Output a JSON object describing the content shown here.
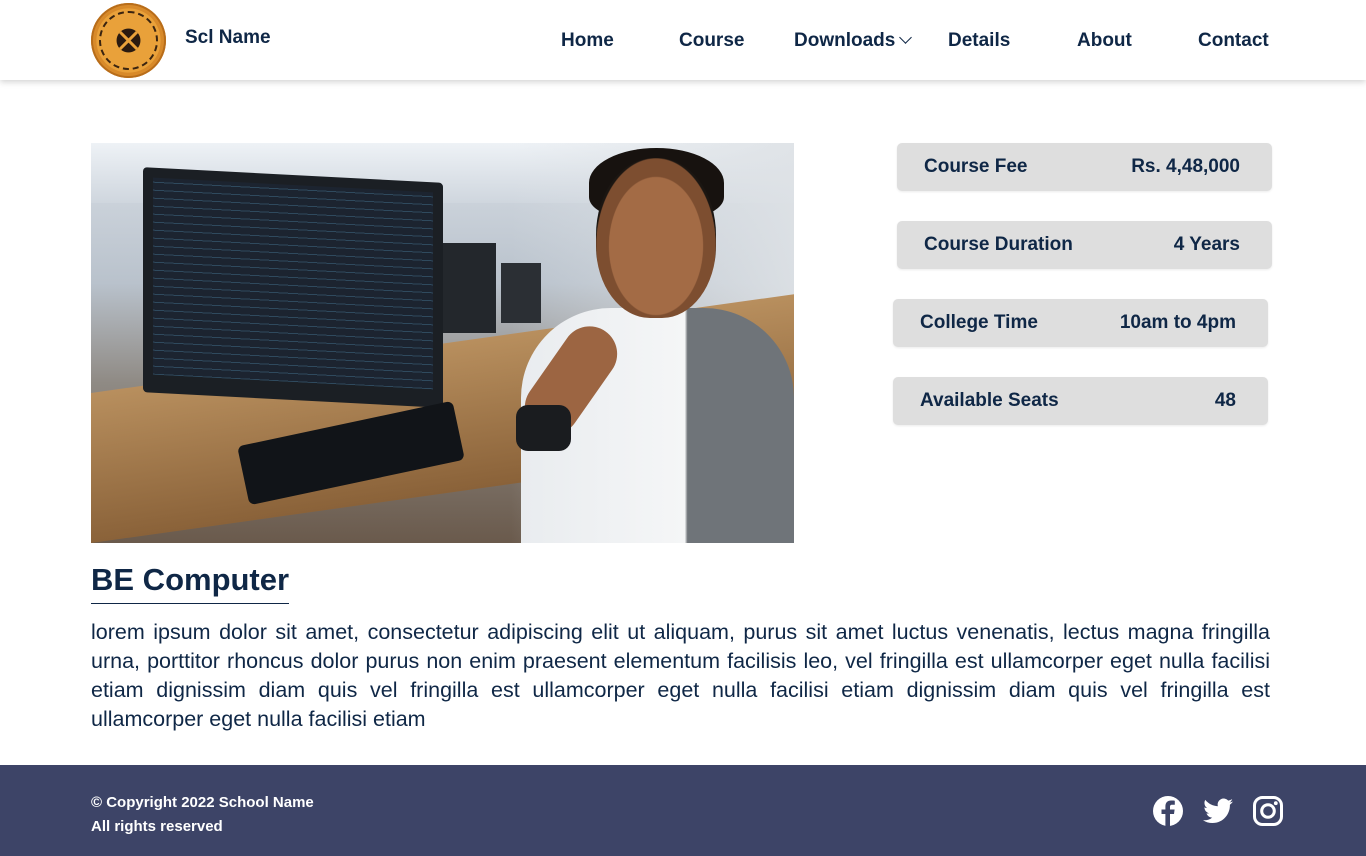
{
  "header": {
    "brand": "Scl Name",
    "nav": {
      "home": "Home",
      "course": "Course",
      "downloads": "Downloads",
      "details": "Details",
      "about": "About",
      "contact": "Contact"
    }
  },
  "info": [
    {
      "label": "Course Fee",
      "value": "Rs. 4,48,000"
    },
    {
      "label": "Course Duration",
      "value": "4 Years"
    },
    {
      "label": "College Time",
      "value": "10am to 4pm"
    },
    {
      "label": "Available Seats",
      "value": "48"
    }
  ],
  "course": {
    "title": "BE Computer",
    "description": "lorem ipsum dolor sit amet, consectetur adipiscing elit ut aliquam, purus sit amet luctus venenatis, lectus magna fringilla urna, porttitor rhoncus dolor purus non enim praesent elementum facilisis leo, vel fringilla est ullamcorper eget nulla facilisi etiam dignissim diam quis vel fringilla est ullamcorper eget nulla facilisi etiam dignissim diam quis vel fringilla est ullamcorper eget nulla facilisi etiam"
  },
  "footer": {
    "copyright": "© Copyright 2022 School Name",
    "rights": "All rights reserved"
  },
  "icons": {
    "downloads_dropdown": "chevron-down-icon",
    "facebook": "facebook-icon",
    "twitter": "twitter-icon",
    "instagram": "instagram-icon"
  },
  "colors": {
    "navy": "#0f2746",
    "footer": "#3d4467",
    "info_box": "#dedede"
  }
}
